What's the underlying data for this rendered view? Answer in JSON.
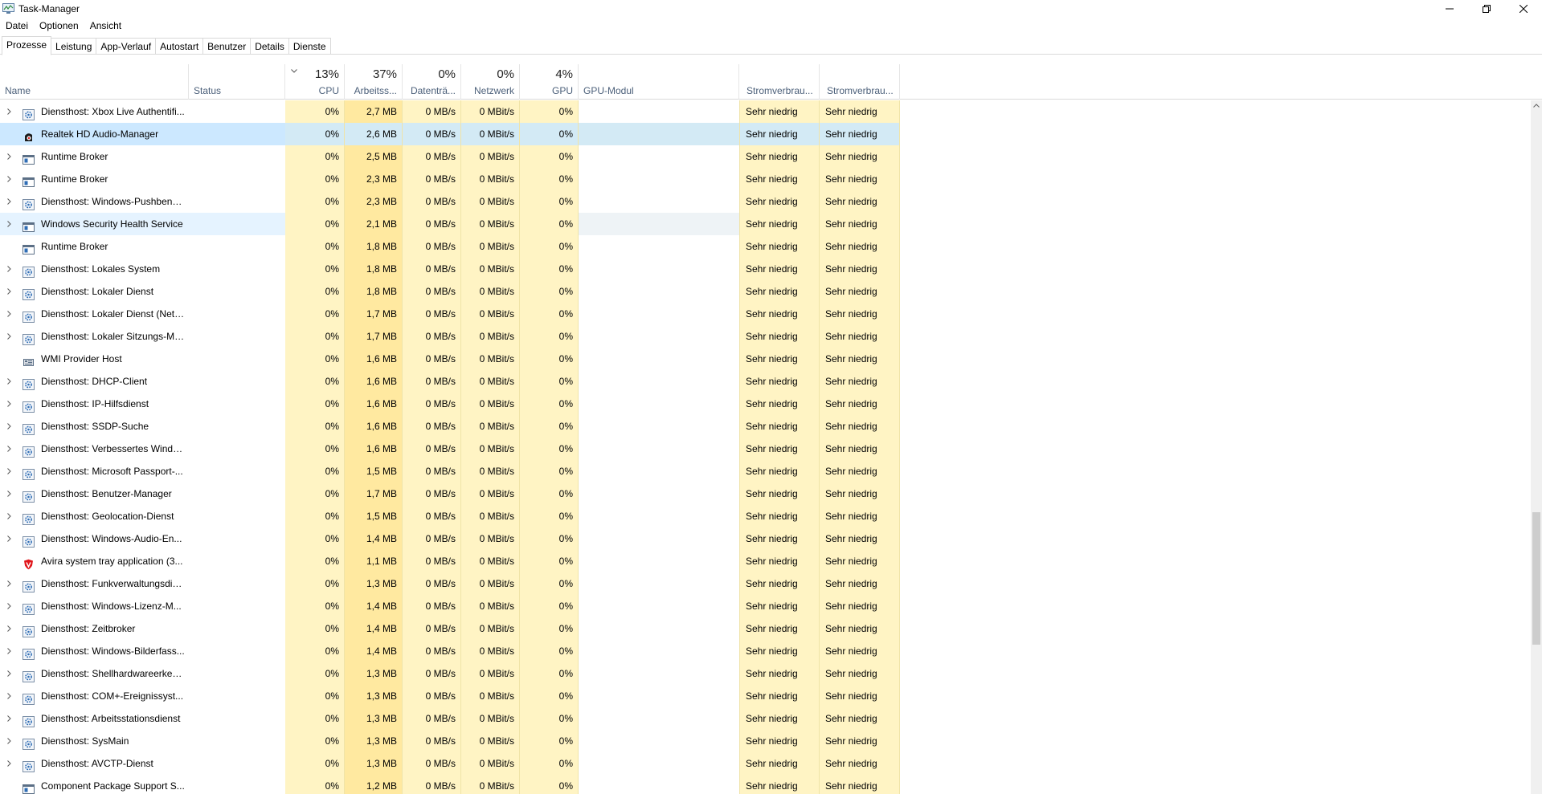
{
  "window": {
    "title": "Task-Manager"
  },
  "menu": [
    "Datei",
    "Optionen",
    "Ansicht"
  ],
  "tabs": [
    "Prozesse",
    "Leistung",
    "App-Verlauf",
    "Autostart",
    "Benutzer",
    "Details",
    "Dienste"
  ],
  "header": {
    "name": "Name",
    "status": "Status",
    "cpu": {
      "pct": "13%",
      "label": "CPU"
    },
    "mem": {
      "pct": "37%",
      "label": "Arbeitss..."
    },
    "disk": {
      "pct": "0%",
      "label": "Datenträ..."
    },
    "net": {
      "pct": "0%",
      "label": "Netzwerk"
    },
    "gpu": {
      "pct": "4%",
      "label": "GPU"
    },
    "gpu_engine": "GPU-Modul",
    "power": "Stromverbrau...",
    "power_trend": "Stromverbrau..."
  },
  "rows": [
    {
      "expander": true,
      "icon": "gear-icon",
      "name": "Diensthost: Xbox Live Authentifi...",
      "cpu": "0%",
      "mem": "2,7 MB",
      "disk": "0 MB/s",
      "net": "0 MBit/s",
      "gpu": "0%",
      "power": "Sehr niedrig",
      "power_trend": "Sehr niedrig"
    },
    {
      "expander": false,
      "icon": "realtek-speaker-icon",
      "name": "Realtek HD Audio-Manager",
      "cpu": "0%",
      "mem": "2,6 MB",
      "disk": "0 MB/s",
      "net": "0 MBit/s",
      "gpu": "0%",
      "power": "Sehr niedrig",
      "power_trend": "Sehr niedrig",
      "state": "selected"
    },
    {
      "expander": true,
      "icon": "window-icon",
      "name": "Runtime Broker",
      "cpu": "0%",
      "mem": "2,5 MB",
      "disk": "0 MB/s",
      "net": "0 MBit/s",
      "gpu": "0%",
      "power": "Sehr niedrig",
      "power_trend": "Sehr niedrig"
    },
    {
      "expander": true,
      "icon": "window-icon",
      "name": "Runtime Broker",
      "cpu": "0%",
      "mem": "2,3 MB",
      "disk": "0 MB/s",
      "net": "0 MBit/s",
      "gpu": "0%",
      "power": "Sehr niedrig",
      "power_trend": "Sehr niedrig"
    },
    {
      "expander": true,
      "icon": "gear-icon",
      "name": "Diensthost: Windows-Pushbena...",
      "cpu": "0%",
      "mem": "2,3 MB",
      "disk": "0 MB/s",
      "net": "0 MBit/s",
      "gpu": "0%",
      "power": "Sehr niedrig",
      "power_trend": "Sehr niedrig"
    },
    {
      "expander": true,
      "icon": "window-icon",
      "name": "Windows Security Health Service",
      "cpu": "0%",
      "mem": "2,1 MB",
      "disk": "0 MB/s",
      "net": "0 MBit/s",
      "gpu": "0%",
      "power": "Sehr niedrig",
      "power_trend": "Sehr niedrig",
      "state": "hover"
    },
    {
      "expander": false,
      "icon": "window-icon",
      "name": "Runtime Broker",
      "cpu": "0%",
      "mem": "1,8 MB",
      "disk": "0 MB/s",
      "net": "0 MBit/s",
      "gpu": "0%",
      "power": "Sehr niedrig",
      "power_trend": "Sehr niedrig"
    },
    {
      "expander": true,
      "icon": "gear-icon",
      "name": "Diensthost: Lokales System",
      "cpu": "0%",
      "mem": "1,8 MB",
      "disk": "0 MB/s",
      "net": "0 MBit/s",
      "gpu": "0%",
      "power": "Sehr niedrig",
      "power_trend": "Sehr niedrig"
    },
    {
      "expander": true,
      "icon": "gear-icon",
      "name": "Diensthost: Lokaler Dienst",
      "cpu": "0%",
      "mem": "1,8 MB",
      "disk": "0 MB/s",
      "net": "0 MBit/s",
      "gpu": "0%",
      "power": "Sehr niedrig",
      "power_trend": "Sehr niedrig"
    },
    {
      "expander": true,
      "icon": "gear-icon",
      "name": "Diensthost: Lokaler Dienst (Netz...",
      "cpu": "0%",
      "mem": "1,7 MB",
      "disk": "0 MB/s",
      "net": "0 MBit/s",
      "gpu": "0%",
      "power": "Sehr niedrig",
      "power_trend": "Sehr niedrig"
    },
    {
      "expander": true,
      "icon": "gear-icon",
      "name": "Diensthost: Lokaler Sitzungs-Ma...",
      "cpu": "0%",
      "mem": "1,7 MB",
      "disk": "0 MB/s",
      "net": "0 MBit/s",
      "gpu": "0%",
      "power": "Sehr niedrig",
      "power_trend": "Sehr niedrig"
    },
    {
      "expander": false,
      "icon": "wmi-icon",
      "name": "WMI Provider Host",
      "cpu": "0%",
      "mem": "1,6 MB",
      "disk": "0 MB/s",
      "net": "0 MBit/s",
      "gpu": "0%",
      "power": "Sehr niedrig",
      "power_trend": "Sehr niedrig"
    },
    {
      "expander": true,
      "icon": "gear-icon",
      "name": "Diensthost: DHCP-Client",
      "cpu": "0%",
      "mem": "1,6 MB",
      "disk": "0 MB/s",
      "net": "0 MBit/s",
      "gpu": "0%",
      "power": "Sehr niedrig",
      "power_trend": "Sehr niedrig"
    },
    {
      "expander": true,
      "icon": "gear-icon",
      "name": "Diensthost: IP-Hilfsdienst",
      "cpu": "0%",
      "mem": "1,6 MB",
      "disk": "0 MB/s",
      "net": "0 MBit/s",
      "gpu": "0%",
      "power": "Sehr niedrig",
      "power_trend": "Sehr niedrig"
    },
    {
      "expander": true,
      "icon": "gear-icon",
      "name": "Diensthost: SSDP-Suche",
      "cpu": "0%",
      "mem": "1,6 MB",
      "disk": "0 MB/s",
      "net": "0 MBit/s",
      "gpu": "0%",
      "power": "Sehr niedrig",
      "power_trend": "Sehr niedrig"
    },
    {
      "expander": true,
      "icon": "gear-icon",
      "name": "Diensthost: Verbessertes Windo...",
      "cpu": "0%",
      "mem": "1,6 MB",
      "disk": "0 MB/s",
      "net": "0 MBit/s",
      "gpu": "0%",
      "power": "Sehr niedrig",
      "power_trend": "Sehr niedrig"
    },
    {
      "expander": true,
      "icon": "gear-icon",
      "name": "Diensthost: Microsoft Passport-...",
      "cpu": "0%",
      "mem": "1,5 MB",
      "disk": "0 MB/s",
      "net": "0 MBit/s",
      "gpu": "0%",
      "power": "Sehr niedrig",
      "power_trend": "Sehr niedrig"
    },
    {
      "expander": true,
      "icon": "gear-icon",
      "name": "Diensthost: Benutzer-Manager",
      "cpu": "0%",
      "mem": "1,7 MB",
      "disk": "0 MB/s",
      "net": "0 MBit/s",
      "gpu": "0%",
      "power": "Sehr niedrig",
      "power_trend": "Sehr niedrig"
    },
    {
      "expander": true,
      "icon": "gear-icon",
      "name": "Diensthost: Geolocation-Dienst",
      "cpu": "0%",
      "mem": "1,5 MB",
      "disk": "0 MB/s",
      "net": "0 MBit/s",
      "gpu": "0%",
      "power": "Sehr niedrig",
      "power_trend": "Sehr niedrig"
    },
    {
      "expander": true,
      "icon": "gear-icon",
      "name": "Diensthost: Windows-Audio-En...",
      "cpu": "0%",
      "mem": "1,4 MB",
      "disk": "0 MB/s",
      "net": "0 MBit/s",
      "gpu": "0%",
      "power": "Sehr niedrig",
      "power_trend": "Sehr niedrig"
    },
    {
      "expander": false,
      "icon": "avira-shield-icon",
      "name": "Avira system tray application (3...",
      "cpu": "0%",
      "mem": "1,1 MB",
      "disk": "0 MB/s",
      "net": "0 MBit/s",
      "gpu": "0%",
      "power": "Sehr niedrig",
      "power_trend": "Sehr niedrig"
    },
    {
      "expander": true,
      "icon": "gear-icon",
      "name": "Diensthost: Funkverwaltungsdie...",
      "cpu": "0%",
      "mem": "1,3 MB",
      "disk": "0 MB/s",
      "net": "0 MBit/s",
      "gpu": "0%",
      "power": "Sehr niedrig",
      "power_trend": "Sehr niedrig"
    },
    {
      "expander": true,
      "icon": "gear-icon",
      "name": "Diensthost: Windows-Lizenz-M...",
      "cpu": "0%",
      "mem": "1,4 MB",
      "disk": "0 MB/s",
      "net": "0 MBit/s",
      "gpu": "0%",
      "power": "Sehr niedrig",
      "power_trend": "Sehr niedrig"
    },
    {
      "expander": true,
      "icon": "gear-icon",
      "name": "Diensthost: Zeitbroker",
      "cpu": "0%",
      "mem": "1,4 MB",
      "disk": "0 MB/s",
      "net": "0 MBit/s",
      "gpu": "0%",
      "power": "Sehr niedrig",
      "power_trend": "Sehr niedrig"
    },
    {
      "expander": true,
      "icon": "gear-icon",
      "name": "Diensthost: Windows-Bilderfass...",
      "cpu": "0%",
      "mem": "1,4 MB",
      "disk": "0 MB/s",
      "net": "0 MBit/s",
      "gpu": "0%",
      "power": "Sehr niedrig",
      "power_trend": "Sehr niedrig"
    },
    {
      "expander": true,
      "icon": "gear-icon",
      "name": "Diensthost: Shellhardwareerken...",
      "cpu": "0%",
      "mem": "1,3 MB",
      "disk": "0 MB/s",
      "net": "0 MBit/s",
      "gpu": "0%",
      "power": "Sehr niedrig",
      "power_trend": "Sehr niedrig"
    },
    {
      "expander": true,
      "icon": "gear-icon",
      "name": "Diensthost: COM+-Ereignissyst...",
      "cpu": "0%",
      "mem": "1,3 MB",
      "disk": "0 MB/s",
      "net": "0 MBit/s",
      "gpu": "0%",
      "power": "Sehr niedrig",
      "power_trend": "Sehr niedrig"
    },
    {
      "expander": true,
      "icon": "gear-icon",
      "name": "Diensthost: Arbeitsstationsdienst",
      "cpu": "0%",
      "mem": "1,3 MB",
      "disk": "0 MB/s",
      "net": "0 MBit/s",
      "gpu": "0%",
      "power": "Sehr niedrig",
      "power_trend": "Sehr niedrig"
    },
    {
      "expander": true,
      "icon": "gear-icon",
      "name": "Diensthost: SysMain",
      "cpu": "0%",
      "mem": "1,3 MB",
      "disk": "0 MB/s",
      "net": "0 MBit/s",
      "gpu": "0%",
      "power": "Sehr niedrig",
      "power_trend": "Sehr niedrig"
    },
    {
      "expander": true,
      "icon": "gear-icon",
      "name": "Diensthost: AVCTP-Dienst",
      "cpu": "0%",
      "mem": "1,3 MB",
      "disk": "0 MB/s",
      "net": "0 MBit/s",
      "gpu": "0%",
      "power": "Sehr niedrig",
      "power_trend": "Sehr niedrig"
    },
    {
      "expander": false,
      "icon": "window-icon",
      "name": "Component Package Support S...",
      "cpu": "0%",
      "mem": "1,2 MB",
      "disk": "0 MB/s",
      "net": "0 MBit/s",
      "gpu": "0%",
      "power": "Sehr niedrig",
      "power_trend": "Sehr niedrig"
    }
  ]
}
